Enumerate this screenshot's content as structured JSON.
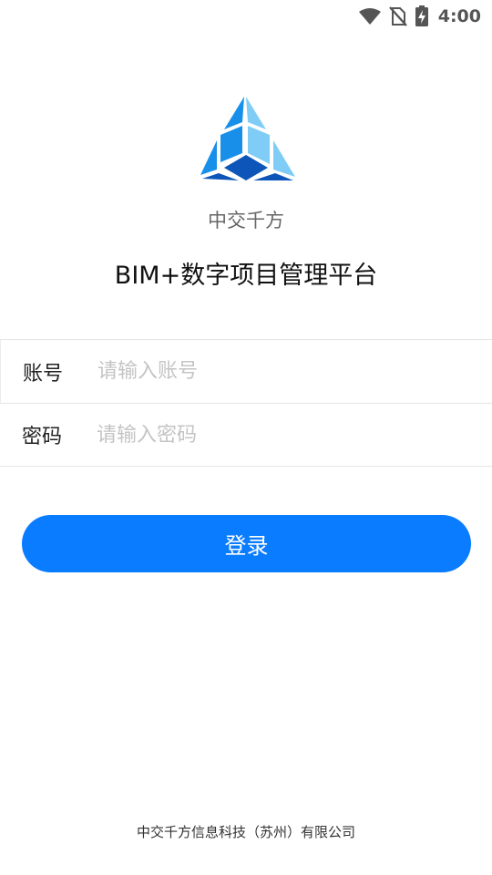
{
  "status_bar": {
    "time": "4:00",
    "icons": [
      "wifi-icon",
      "no-sim-icon",
      "battery-charging-icon"
    ]
  },
  "brand": {
    "company_name": "中交千方",
    "app_title": "BIM+数字项目管理平台",
    "logo_colors": {
      "light": "#7fcdf7",
      "mid": "#1890ea",
      "dark": "#0d55b8"
    }
  },
  "login_form": {
    "account": {
      "label": "账号",
      "value": "",
      "placeholder": "请输入账号"
    },
    "password": {
      "label": "密码",
      "value": "",
      "placeholder": "请输入密码"
    },
    "submit_label": "登录"
  },
  "footer": {
    "text": "中交千方信息科技（苏州）有限公司"
  },
  "colors": {
    "accent": "#0a7cff",
    "placeholder": "#c4c4c4",
    "divider": "#e6e6e6"
  }
}
